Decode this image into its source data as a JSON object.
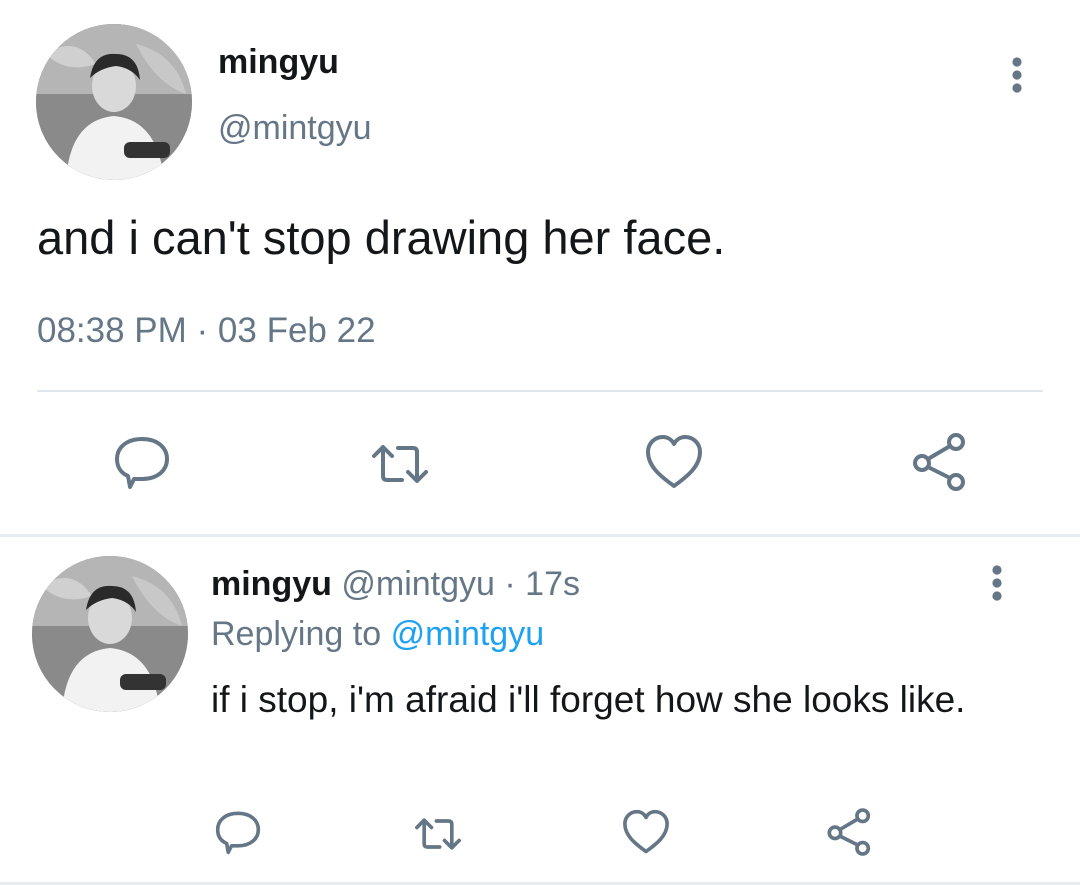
{
  "main_tweet": {
    "avatar_icon": "profile-photo",
    "display_name": "mingyu",
    "handle": "@mintgyu",
    "text": "and i can't stop drawing her face.",
    "timestamp": "08:38 PM · 03 Feb 22",
    "actions": [
      "reply-icon",
      "retweet-icon",
      "like-icon",
      "share-icon"
    ]
  },
  "reply_tweet": {
    "avatar_icon": "profile-photo",
    "display_name": "mingyu",
    "handle": "@mintgyu",
    "separator": "·",
    "time_ago": "17s",
    "replying_label": "Replying to",
    "replying_to": "@mintgyu",
    "text": "if i stop, i'm afraid i'll forget how she looks like.",
    "actions": [
      "reply-icon",
      "retweet-icon",
      "like-icon",
      "share-icon"
    ]
  },
  "colors": {
    "text_primary": "#14171a",
    "text_secondary": "#657786",
    "link": "#1da1f2",
    "icon": "#657786",
    "divider": "#e1e8ed"
  }
}
